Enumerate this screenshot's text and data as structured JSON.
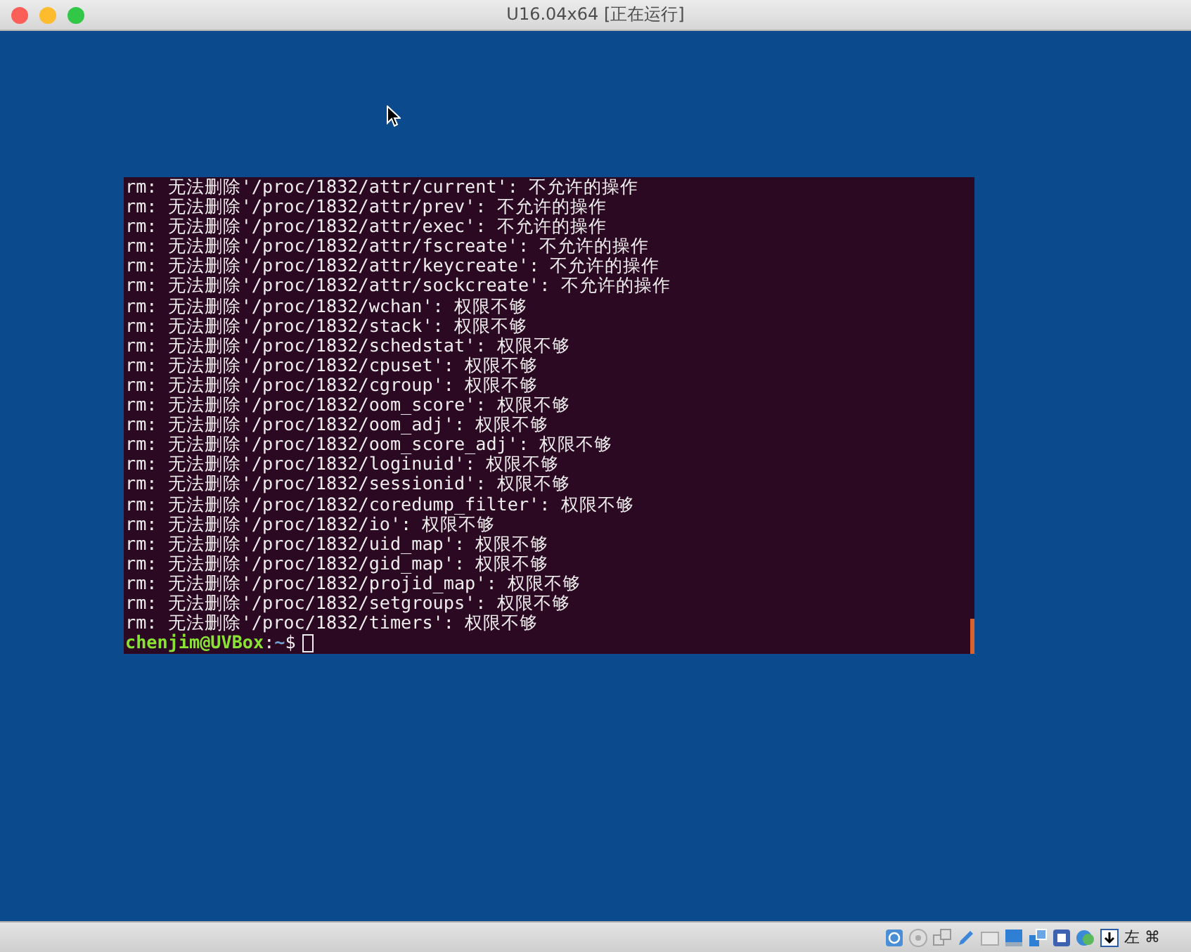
{
  "window": {
    "title": "U16.04x64 [正在运行]"
  },
  "terminal": {
    "lines": [
      "rm: 无法删除'/proc/1832/attr/current': 不允许的操作",
      "rm: 无法删除'/proc/1832/attr/prev': 不允许的操作",
      "rm: 无法删除'/proc/1832/attr/exec': 不允许的操作",
      "rm: 无法删除'/proc/1832/attr/fscreate': 不允许的操作",
      "rm: 无法删除'/proc/1832/attr/keycreate': 不允许的操作",
      "rm: 无法删除'/proc/1832/attr/sockcreate': 不允许的操作",
      "rm: 无法删除'/proc/1832/wchan': 权限不够",
      "rm: 无法删除'/proc/1832/stack': 权限不够",
      "rm: 无法删除'/proc/1832/schedstat': 权限不够",
      "rm: 无法删除'/proc/1832/cpuset': 权限不够",
      "rm: 无法删除'/proc/1832/cgroup': 权限不够",
      "rm: 无法删除'/proc/1832/oom_score': 权限不够",
      "rm: 无法删除'/proc/1832/oom_adj': 权限不够",
      "rm: 无法删除'/proc/1832/oom_score_adj': 权限不够",
      "rm: 无法删除'/proc/1832/loginuid': 权限不够",
      "rm: 无法删除'/proc/1832/sessionid': 权限不够",
      "rm: 无法删除'/proc/1832/coredump_filter': 权限不够",
      "rm: 无法删除'/proc/1832/io': 权限不够",
      "rm: 无法删除'/proc/1832/uid_map': 权限不够",
      "rm: 无法删除'/proc/1832/gid_map': 权限不够",
      "rm: 无法删除'/proc/1832/projid_map': 权限不够",
      "rm: 无法删除'/proc/1832/setgroups': 权限不够",
      "rm: 无法删除'/proc/1832/timers': 权限不够"
    ],
    "prompt": {
      "user_host": "chenjim@UVBox",
      "separator": ":",
      "path": "~",
      "symbol": "$"
    }
  },
  "status_bar": {
    "host_key": "左 ⌘"
  }
}
